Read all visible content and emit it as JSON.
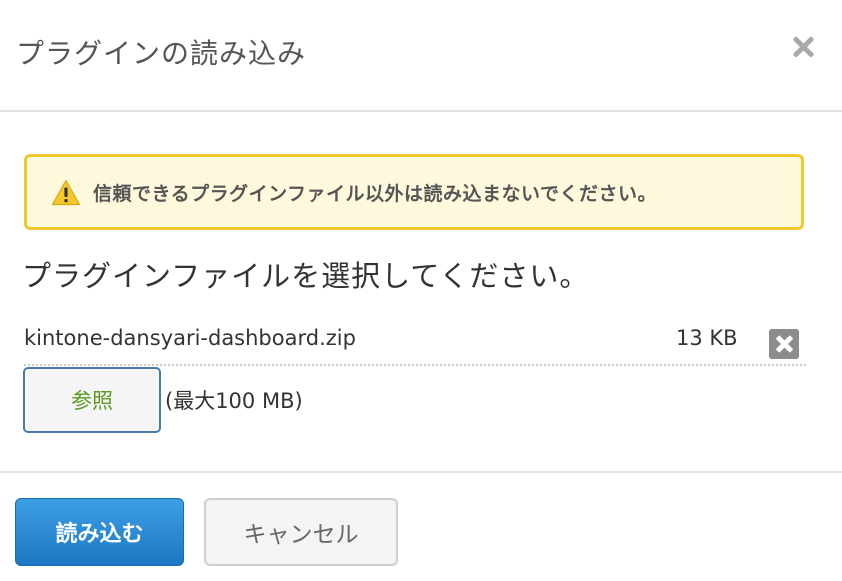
{
  "dialog": {
    "title": "プラグインの読み込み"
  },
  "warning": {
    "text": "信頼できるプラグインファイル以外は読み込まないでください。",
    "icon": "warning-triangle-icon",
    "border_color": "#f2c82b",
    "background_color": "#fef9dc"
  },
  "select_label": "プラグインファイルを選択してください。",
  "file": {
    "name": "kintone-dansyari-dashboard.zip",
    "size": "13 KB"
  },
  "browse": {
    "label": "参照",
    "max_size": "(最大100 MB)"
  },
  "footer": {
    "import_label": "読み込む",
    "cancel_label": "キャンセル"
  },
  "colors": {
    "primary": "#1d78c4",
    "browse_text": "#5a9a22"
  }
}
